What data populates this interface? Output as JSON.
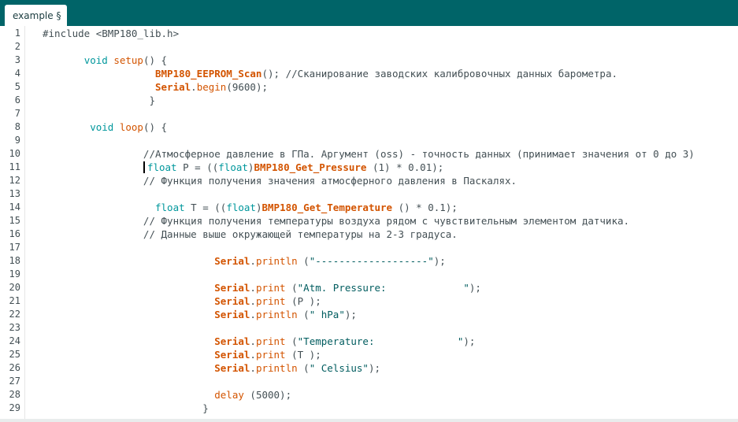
{
  "tab": {
    "label": "example §"
  },
  "code": {
    "lines": [
      {
        "n": "1",
        "t": [
          [
            "p",
            "#include <BMP180_lib.h>"
          ]
        ]
      },
      {
        "n": "2",
        "t": []
      },
      {
        "n": "3",
        "t": [
          [
            "p",
            "       "
          ],
          [
            "kw",
            "void"
          ],
          [
            "p",
            " "
          ],
          [
            "fnn",
            "setup"
          ],
          [
            "p",
            "() {"
          ]
        ]
      },
      {
        "n": "4",
        "t": [
          [
            "p",
            "                   "
          ],
          [
            "fn",
            "BMP180_EEPROM_Scan"
          ],
          [
            "p",
            "(); //Сканирование заводских калибровочных данных барометра."
          ]
        ]
      },
      {
        "n": "5",
        "t": [
          [
            "p",
            "                   "
          ],
          [
            "fn",
            "Serial"
          ],
          [
            "p",
            "."
          ],
          [
            "fnn",
            "begin"
          ],
          [
            "p",
            "(9600);"
          ]
        ]
      },
      {
        "n": "6",
        "t": [
          [
            "p",
            "                  }"
          ]
        ]
      },
      {
        "n": "7",
        "t": []
      },
      {
        "n": "8",
        "t": [
          [
            "p",
            "        "
          ],
          [
            "kw",
            "void"
          ],
          [
            "p",
            " "
          ],
          [
            "fnn",
            "loop"
          ],
          [
            "p",
            "() {"
          ]
        ]
      },
      {
        "n": "9",
        "t": []
      },
      {
        "n": "10",
        "t": [
          [
            "p",
            "                 //Атмосферное давление в ГПа. Аргумент (oss) - точность данных (принимает значения от 0 до 3)"
          ]
        ]
      },
      {
        "n": "11",
        "t": [
          [
            "p",
            "                 "
          ],
          [
            "cur",
            ""
          ],
          [
            "kw",
            "float"
          ],
          [
            "p",
            " P = (("
          ],
          [
            "kw",
            "float"
          ],
          [
            "p",
            ")"
          ],
          [
            "fn",
            "BMP180_Get_Pressure"
          ],
          [
            "p",
            " (1) * 0.01);"
          ]
        ]
      },
      {
        "n": "12",
        "t": [
          [
            "p",
            "                 // Функция получения значения атмосферного давления в Паскалях."
          ]
        ]
      },
      {
        "n": "13",
        "t": []
      },
      {
        "n": "14",
        "t": [
          [
            "p",
            "                   "
          ],
          [
            "kw",
            "float"
          ],
          [
            "p",
            " T = (("
          ],
          [
            "kw",
            "float"
          ],
          [
            "p",
            ")"
          ],
          [
            "fn",
            "BMP180_Get_Temperature"
          ],
          [
            "p",
            " () * 0.1);"
          ]
        ]
      },
      {
        "n": "15",
        "t": [
          [
            "p",
            "                 // Функция получения температуры воздуха рядом с чувствительным элементом датчика."
          ]
        ]
      },
      {
        "n": "16",
        "t": [
          [
            "p",
            "                 // Данные выше окружающей температуры на 2-3 градуса."
          ]
        ]
      },
      {
        "n": "17",
        "t": []
      },
      {
        "n": "18",
        "t": [
          [
            "p",
            "                             "
          ],
          [
            "fn",
            "Serial"
          ],
          [
            "p",
            "."
          ],
          [
            "fnn",
            "println"
          ],
          [
            "p",
            " ("
          ],
          [
            "st",
            "\"-------------------\""
          ],
          [
            "p",
            ");"
          ]
        ]
      },
      {
        "n": "19",
        "t": []
      },
      {
        "n": "20",
        "t": [
          [
            "p",
            "                             "
          ],
          [
            "fn",
            "Serial"
          ],
          [
            "p",
            "."
          ],
          [
            "fnn",
            "print"
          ],
          [
            "p",
            " ("
          ],
          [
            "st",
            "\"Atm. Pressure:             \""
          ],
          [
            "p",
            ");"
          ]
        ]
      },
      {
        "n": "21",
        "t": [
          [
            "p",
            "                             "
          ],
          [
            "fn",
            "Serial"
          ],
          [
            "p",
            "."
          ],
          [
            "fnn",
            "print"
          ],
          [
            "p",
            " (P );"
          ]
        ]
      },
      {
        "n": "22",
        "t": [
          [
            "p",
            "                             "
          ],
          [
            "fn",
            "Serial"
          ],
          [
            "p",
            "."
          ],
          [
            "fnn",
            "println"
          ],
          [
            "p",
            " ("
          ],
          [
            "st",
            "\" hPa\""
          ],
          [
            "p",
            ");"
          ]
        ]
      },
      {
        "n": "23",
        "t": []
      },
      {
        "n": "24",
        "t": [
          [
            "p",
            "                             "
          ],
          [
            "fn",
            "Serial"
          ],
          [
            "p",
            "."
          ],
          [
            "fnn",
            "print"
          ],
          [
            "p",
            " ("
          ],
          [
            "st",
            "\"Temperature:              \""
          ],
          [
            "p",
            ");"
          ]
        ]
      },
      {
        "n": "25",
        "t": [
          [
            "p",
            "                             "
          ],
          [
            "fn",
            "Serial"
          ],
          [
            "p",
            "."
          ],
          [
            "fnn",
            "print"
          ],
          [
            "p",
            " (T );"
          ]
        ]
      },
      {
        "n": "26",
        "t": [
          [
            "p",
            "                             "
          ],
          [
            "fn",
            "Serial"
          ],
          [
            "p",
            "."
          ],
          [
            "fnn",
            "println"
          ],
          [
            "p",
            " ("
          ],
          [
            "st",
            "\" Celsius\""
          ],
          [
            "p",
            ");"
          ]
        ]
      },
      {
        "n": "27",
        "t": []
      },
      {
        "n": "28",
        "t": [
          [
            "p",
            "                             "
          ],
          [
            "fnn",
            "delay"
          ],
          [
            "p",
            " (5000);"
          ]
        ]
      },
      {
        "n": "29",
        "t": [
          [
            "p",
            "                           }"
          ]
        ]
      }
    ]
  },
  "colors": {
    "tabbar": "#006468",
    "keyword": "#00979c",
    "function": "#d35400",
    "string": "#005c5f",
    "text": "#434f54"
  }
}
